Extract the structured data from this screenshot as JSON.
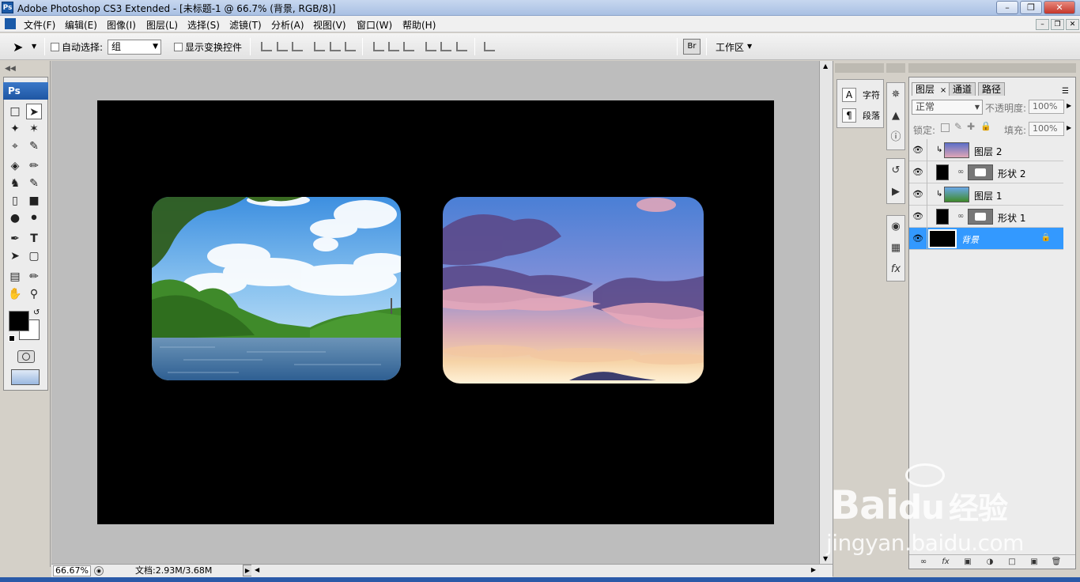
{
  "window": {
    "app_badge": "Ps",
    "title": "Adobe Photoshop CS3 Extended - [未标题-1 @ 66.7% (背景, RGB/8)]",
    "minimize": "0",
    "maximize": "1",
    "close": "r"
  },
  "menu": {
    "items": [
      "文件(F)",
      "编辑(E)",
      "图像(I)",
      "图层(L)",
      "选择(S)",
      "滤镜(T)",
      "分析(A)",
      "视图(V)",
      "窗口(W)",
      "帮助(H)"
    ]
  },
  "options": {
    "auto_select_label": "自动选择:",
    "auto_select_value": "组",
    "show_transform_label": "显示变换控件",
    "workspace_label": "工作区"
  },
  "tools": {
    "header": "Ps"
  },
  "document": {
    "zoom": "66.67%",
    "doc_size": "文档:2.93M/3.68M"
  },
  "mini_panel": {
    "character": "字符",
    "paragraph": "段落"
  },
  "layers_panel": {
    "tabs": [
      "图层",
      "通道",
      "路径"
    ],
    "blend_mode": "正常",
    "opacity_label": "不透明度:",
    "opacity_value": "100%",
    "lock_label": "锁定:",
    "fill_label": "填充:",
    "fill_value": "100%",
    "layers": [
      {
        "name": "图层 2",
        "kind": "image-clipped",
        "visible": true,
        "selected": false
      },
      {
        "name": "形状 2",
        "kind": "shape",
        "visible": true,
        "selected": false
      },
      {
        "name": "图层 1",
        "kind": "image-clipped",
        "visible": true,
        "selected": false
      },
      {
        "name": "形状 1",
        "kind": "shape",
        "visible": true,
        "selected": false
      },
      {
        "name": "背景",
        "kind": "background",
        "visible": true,
        "selected": true,
        "locked": true
      }
    ]
  },
  "watermark": {
    "brand": "Bai",
    "brand2": "du",
    "brand_cn": "经验",
    "url": "jingyan.baidu.com"
  }
}
